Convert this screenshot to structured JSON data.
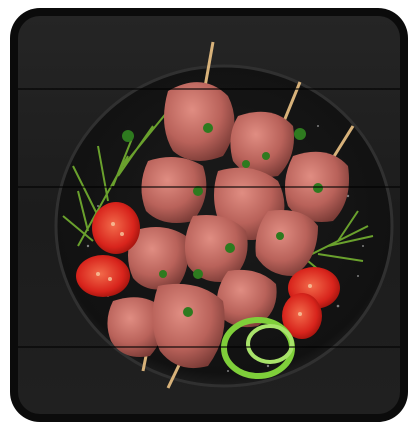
{
  "image": {
    "subject": "",
    "colors": {
      "frame": "#0b0b0b",
      "background": "#222222",
      "plate": "#141414",
      "meat": "#b9625a",
      "tomato": "#d8241c",
      "dill": "#6aa12d",
      "onion": "#7fcf3a",
      "skewer": "#d8b27a"
    }
  }
}
